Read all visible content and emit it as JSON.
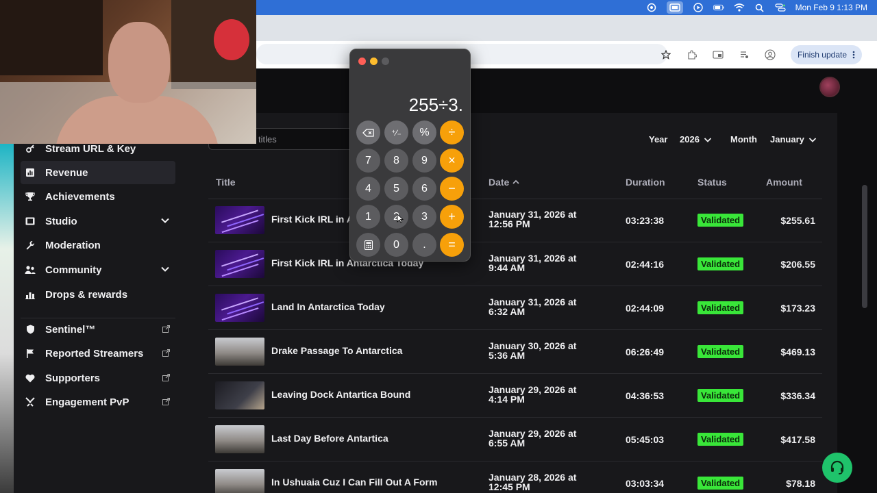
{
  "menubar": {
    "clock": "Mon Feb 9  1:13 PM",
    "icons": [
      "creative-cloud-icon",
      "screen-record-icon",
      "play-icon",
      "battery-icon",
      "wifi-icon",
      "search-icon",
      "control-center-icon"
    ]
  },
  "browser": {
    "finish_update": "Finish update",
    "toolbar_icons": [
      "star-icon",
      "extensions-icon",
      "cast-icon",
      "media-icon",
      "profile-icon",
      "menu-icon"
    ]
  },
  "search": {
    "placeholder": "titles"
  },
  "filters": {
    "year_label": "Year",
    "year_value": "2026",
    "month_label": "Month",
    "month_value": "January"
  },
  "sidebar": {
    "items": [
      {
        "label": "Stream URL & Key",
        "icon": "key-icon"
      },
      {
        "label": "Revenue",
        "icon": "bar-chart-icon",
        "active": true
      },
      {
        "label": "Achievements",
        "icon": "trophy-icon"
      },
      {
        "label": "Studio",
        "icon": "film-icon",
        "expandable": true
      },
      {
        "label": "Moderation",
        "icon": "wrench-icon"
      },
      {
        "label": "Community",
        "icon": "people-icon",
        "expandable": true
      },
      {
        "label": "Drops & rewards",
        "icon": "gift-icon"
      },
      {
        "label": "Sentinel™",
        "icon": "shield-icon",
        "external": true
      },
      {
        "label": "Reported Streamers",
        "icon": "flag-icon",
        "external": true
      },
      {
        "label": "Supporters",
        "icon": "heart-icon",
        "external": true
      },
      {
        "label": "Engagement PvP",
        "icon": "swords-icon",
        "external": true
      }
    ]
  },
  "table": {
    "headers": {
      "title": "Title",
      "date": "Date",
      "duration": "Duration",
      "status": "Status",
      "amount": "Amount"
    },
    "rows": [
      {
        "title": "First Kick IRL in A",
        "date": "January 31, 2026 at 12:56 PM",
        "duration": "03:23:38",
        "status": "Validated",
        "amount": "$255.61",
        "thumb": "space"
      },
      {
        "title": "First Kick IRL in Antarctica Today",
        "date": "January 31, 2026 at 9:44 AM",
        "duration": "02:44:16",
        "status": "Validated",
        "amount": "$206.55",
        "thumb": "space"
      },
      {
        "title": "Land In Antarctica Today",
        "date": "January 31, 2026 at 6:32 AM",
        "duration": "02:44:09",
        "status": "Validated",
        "amount": "$173.23",
        "thumb": "space"
      },
      {
        "title": "Drake Passage To Antarctica",
        "date": "January 30, 2026 at 5:36 AM",
        "duration": "06:26:49",
        "status": "Validated",
        "amount": "$469.13",
        "thumb": "video"
      },
      {
        "title": "Leaving Dock Antartica Bound",
        "date": "January 29, 2026 at 4:14 PM",
        "duration": "04:36:53",
        "status": "Validated",
        "amount": "$336.34",
        "thumb": "dark"
      },
      {
        "title": "Last Day Before Antartica",
        "date": "January 29, 2026 at 6:55 AM",
        "duration": "05:45:03",
        "status": "Validated",
        "amount": "$417.58",
        "thumb": "video"
      },
      {
        "title": "In Ushuaia Cuz I Can Fill Out A Form",
        "date": "January 28, 2026 at 12:45 PM",
        "duration": "03:03:34",
        "status": "Validated",
        "amount": "$78.18",
        "thumb": "video"
      }
    ]
  },
  "calculator": {
    "display": "255÷3.",
    "keys": [
      [
        "⌫",
        "⁺∕₋",
        "%",
        "÷"
      ],
      [
        "7",
        "8",
        "9",
        "×"
      ],
      [
        "4",
        "5",
        "6",
        "−"
      ],
      [
        "1",
        "2",
        "3",
        "+"
      ],
      [
        "▦",
        "0",
        ".",
        "="
      ]
    ]
  },
  "colors": {
    "accent_green": "#39e639",
    "calc_orange": "#f7a00a",
    "menubar_blue": "#2f6fd6",
    "help_green": "#1fc36b"
  }
}
